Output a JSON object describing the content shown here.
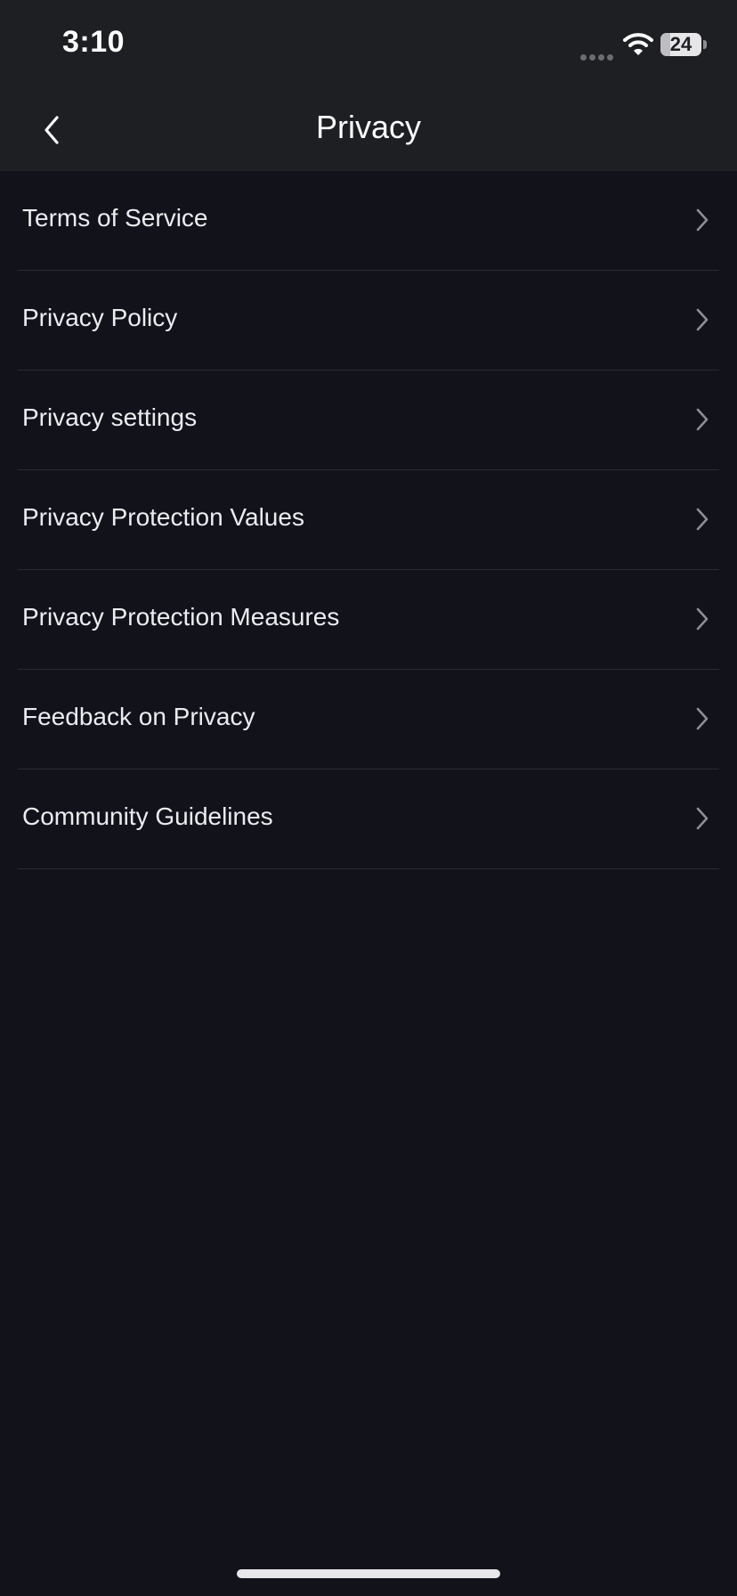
{
  "status_bar": {
    "time": "3:10",
    "battery_percent": "24",
    "battery_level": 0.24,
    "icons": [
      "signal-dots-icon",
      "wifi-icon",
      "battery-icon"
    ]
  },
  "nav": {
    "title": "Privacy",
    "back_icon": "chevron-left-icon"
  },
  "menu": {
    "items": [
      {
        "label": "Terms of Service"
      },
      {
        "label": "Privacy Policy"
      },
      {
        "label": "Privacy settings"
      },
      {
        "label": "Privacy Protection Values"
      },
      {
        "label": "Privacy Protection Measures"
      },
      {
        "label": "Feedback on Privacy"
      },
      {
        "label": "Community Guidelines"
      }
    ],
    "item_icon": "chevron-right-icon"
  },
  "colors": {
    "background": "#11121a",
    "header_background": "#1e1f23",
    "text": "#ececef",
    "divider": "#2a2b33",
    "chevron": "#8e8e92"
  }
}
